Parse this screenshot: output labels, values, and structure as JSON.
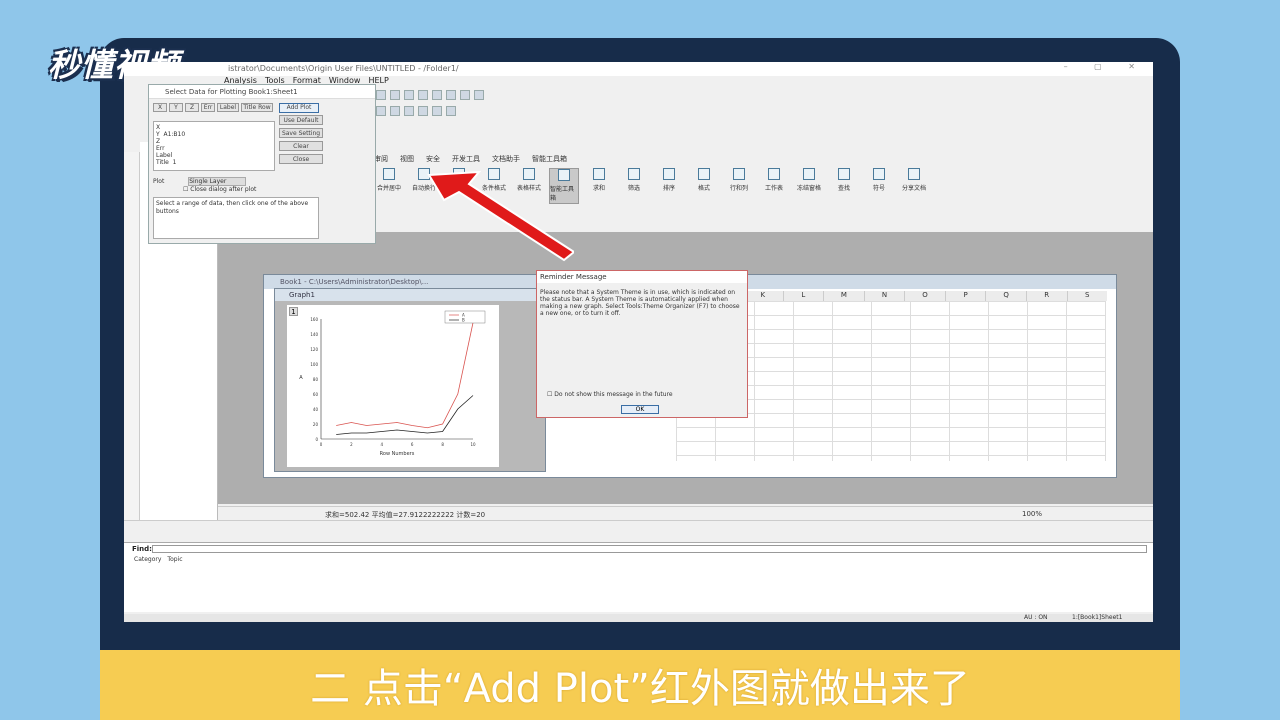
{
  "brand": {
    "logo_text": "秒懂视频"
  },
  "caption": {
    "text": "二 点击“Add Plot”红外图就做出来了"
  },
  "app": {
    "title_fragment": "istrator\\Documents\\Origin User Files\\UNTITLED - /Folder1/",
    "menu": [
      "Analysis",
      "Tools",
      "Format",
      "Window",
      "HELP"
    ],
    "ribbon_tabs": [
      "审阅",
      "视图",
      "安全",
      "开发工具",
      "文档助手",
      "智能工具箱"
    ],
    "ribbon_buttons": [
      "合并居中",
      "自动换行",
      "常规",
      "条件格式",
      "表格样式",
      "智能工具箱",
      "求和",
      "筛选",
      "排序",
      "格式",
      "行和列",
      "工作表",
      "冻结窗格",
      "查找",
      "符号",
      "分享文档"
    ],
    "status_bar": "求和=502.42  平均值=27.9122222222  计数=20",
    "zoom": "100%",
    "find_label": "Find:",
    "find_columns": [
      "Category",
      "Topic"
    ],
    "bottom_status": [
      "AU : ON",
      "1:[Book1]Sheet1"
    ]
  },
  "select_dialog": {
    "title": "Select Data for Plotting  Book1:Sheet1",
    "buttons": [
      "X",
      "Y",
      "Z",
      "Err",
      "Label",
      "Title Row"
    ],
    "add_plot": "Add Plot",
    "side_buttons": [
      "Use Default",
      "Save Setting",
      "Clear",
      "Close"
    ],
    "list_text": "X\nY  A1:B10\nZ\nErr\nLabel\nTitle  1",
    "plot_label": "Plot",
    "layer_option": "Single Layer",
    "close_checkbox": "Close dialog after plot",
    "info": "Select a range of data, then click one of the above buttons"
  },
  "book_window": {
    "title": "Book1 - C:\\Users\\Administrator\\Desktop\\...",
    "columns": [
      "K",
      "L",
      "M",
      "N",
      "O",
      "P",
      "Q",
      "R",
      "S"
    ]
  },
  "graph_window": {
    "title": "Graph1",
    "layer": "1",
    "xlabel": "Row Numbers",
    "ylabel": "A",
    "legend": [
      "A",
      "B"
    ]
  },
  "chart_data": {
    "type": "line",
    "x": [
      1,
      2,
      3,
      4,
      5,
      6,
      7,
      8,
      9,
      10
    ],
    "series": [
      {
        "name": "A",
        "color": "#d9534f",
        "values": [
          18,
          22,
          18,
          20,
          22,
          18,
          15,
          20,
          60,
          155
        ]
      },
      {
        "name": "B",
        "color": "#222222",
        "values": [
          6,
          8,
          8,
          10,
          12,
          10,
          8,
          10,
          40,
          58
        ]
      }
    ],
    "xlabel": "Row Numbers",
    "ylabel": "A",
    "xlim": [
      0,
      10
    ],
    "ylim": [
      0,
      160
    ]
  },
  "reminder": {
    "title": "Reminder Message",
    "body": "Please note that a System Theme is in use, which is indicated on the status bar. A System Theme is automatically applied when making a new graph. Select Tools:Theme Organizer (F7) to choose a new one, or to turn it off.",
    "checkbox": "Do not show this message in the future",
    "ok": "OK"
  }
}
